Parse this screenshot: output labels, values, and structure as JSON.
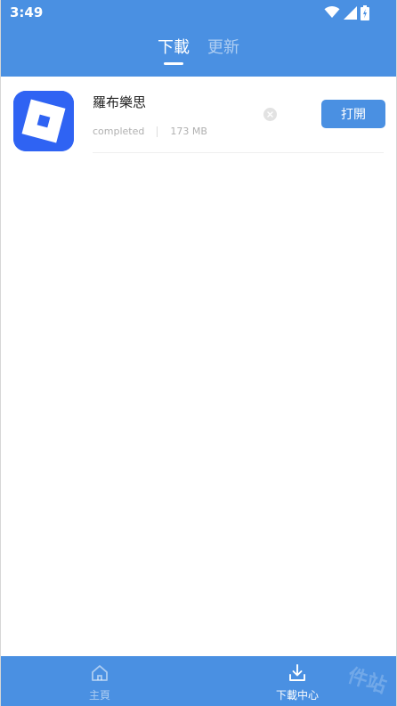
{
  "status_bar": {
    "time": "3:49",
    "icons": [
      "wifi-icon",
      "signal-icon",
      "battery-icon"
    ]
  },
  "tabs": [
    {
      "label": "下載",
      "active": true
    },
    {
      "label": "更新",
      "active": false
    }
  ],
  "downloads": [
    {
      "name": "羅布樂思",
      "status": "completed",
      "size": "173 MB",
      "icon_color": "#2f63f3",
      "action_label": "打開"
    }
  ],
  "bottom_nav": [
    {
      "label": "主頁",
      "icon": "home-icon",
      "active": false
    },
    {
      "label": "下載中心",
      "icon": "download-icon",
      "active": true
    }
  ],
  "watermark": "件站",
  "colors": {
    "primary": "#4a90e2",
    "app_icon": "#2f63f3"
  }
}
